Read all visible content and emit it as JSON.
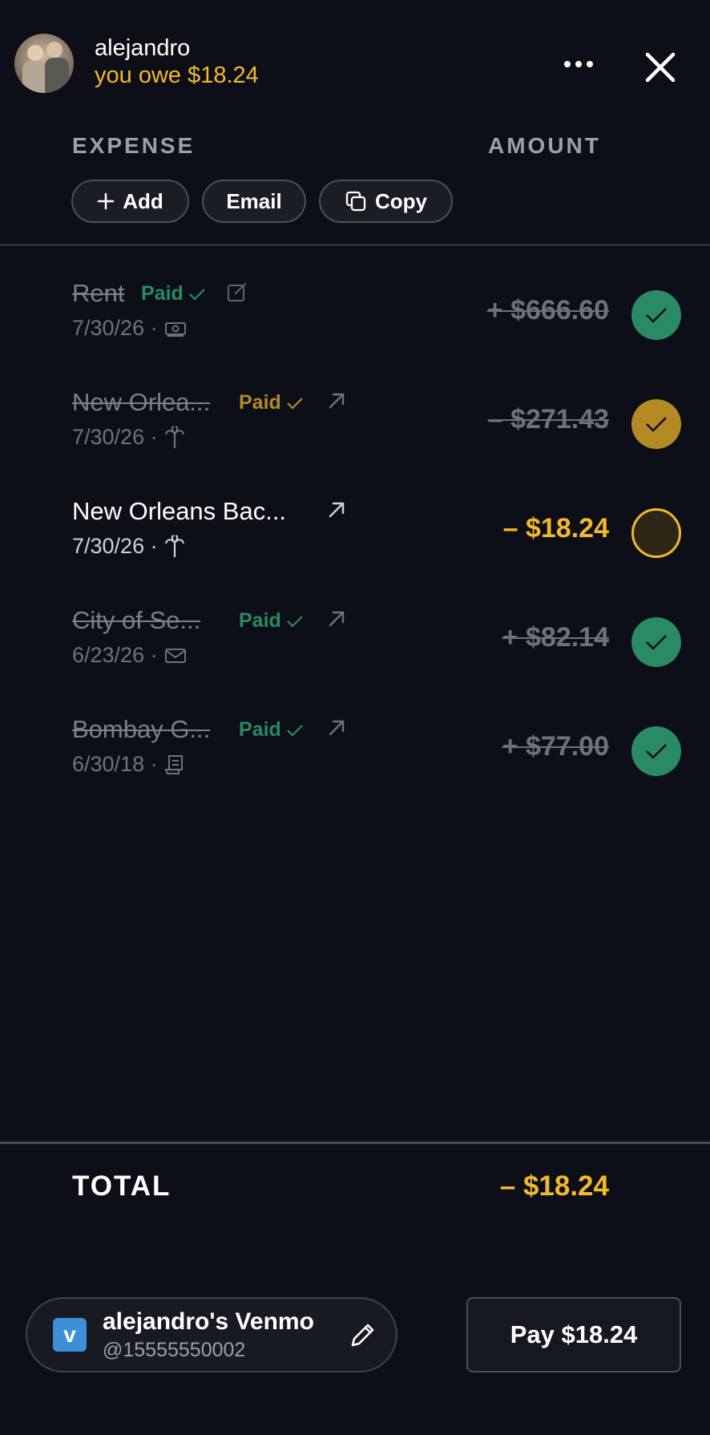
{
  "header": {
    "username": "alejandro",
    "owe_text": "you owe $18.24"
  },
  "columns": {
    "expense": "EXPENSE",
    "amount": "AMOUNT"
  },
  "actions": {
    "add": "Add",
    "email": "Email",
    "copy": "Copy"
  },
  "expenses": [
    {
      "title": "Rent",
      "paid_label": "Paid",
      "date": "7/30/26 ·",
      "category_icon": "cash-icon",
      "amount": "+ $666.60",
      "status": "paid-green"
    },
    {
      "title": "New Orlea...",
      "paid_label": "Paid",
      "date": "7/30/26 ·",
      "category_icon": "palm-tree-icon",
      "amount": "– $271.43",
      "status": "paid-yellow"
    },
    {
      "title": "New Orleans Bac...",
      "paid_label": "",
      "date": "7/30/26 ·",
      "category_icon": "palm-tree-icon",
      "amount": "– $18.24",
      "status": "unpaid"
    },
    {
      "title": "City of Se...",
      "paid_label": "Paid",
      "date": "6/23/26 ·",
      "category_icon": "envelope-icon",
      "amount": "+ $82.14",
      "status": "paid-green"
    },
    {
      "title": "Bombay G...",
      "paid_label": "Paid",
      "date": "6/30/18 ·",
      "category_icon": "receipt-icon",
      "amount": "+ $77.00",
      "status": "paid-green"
    }
  ],
  "total": {
    "label": "TOTAL",
    "amount": "– $18.24"
  },
  "payment": {
    "venmo_logo": "v",
    "venmo_name": "alejandro's Venmo",
    "venmo_handle": "@15555550002",
    "pay_label": "Pay $18.24"
  },
  "colors": {
    "background": "#0c0f17",
    "accent_yellow": "#f3b92b",
    "paid_green": "#2a8a63",
    "paid_yellow": "#b38a23",
    "venmo_blue": "#3c8fd6"
  }
}
